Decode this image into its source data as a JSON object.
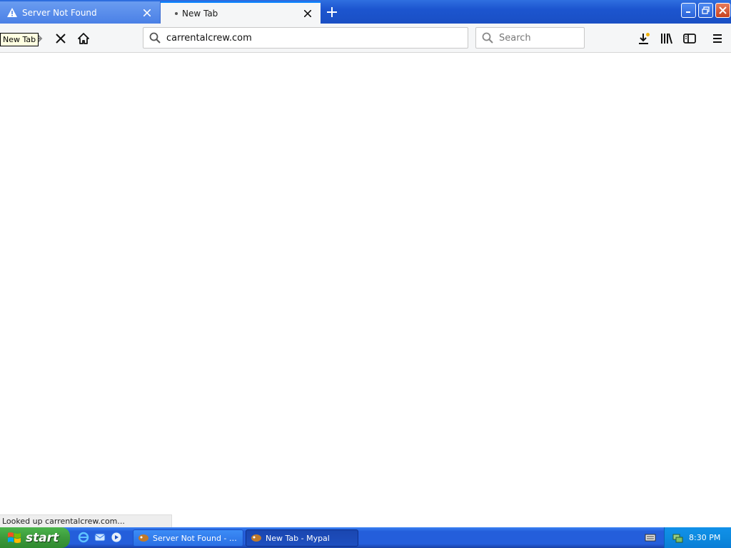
{
  "tabs": [
    {
      "title": "Server Not Found",
      "icon": "warning-icon",
      "active": false
    },
    {
      "title": "New Tab",
      "icon": "loading-dot-icon",
      "active": true
    }
  ],
  "navbar": {
    "url": "carrentalcrew.com",
    "search_placeholder": "Search",
    "tooltip": "New Tab"
  },
  "status": {
    "text": "Looked up carrentalcrew.com..."
  },
  "taskbar": {
    "start_label": "start",
    "tasks": [
      {
        "label": "Server Not Found - M..."
      },
      {
        "label": "New Tab - Mypal"
      }
    ],
    "clock": "8:30 PM"
  },
  "colors": {
    "tab_accent": "#0a84ff",
    "taskbar": "#245edb",
    "start": "#3c9a3c"
  }
}
